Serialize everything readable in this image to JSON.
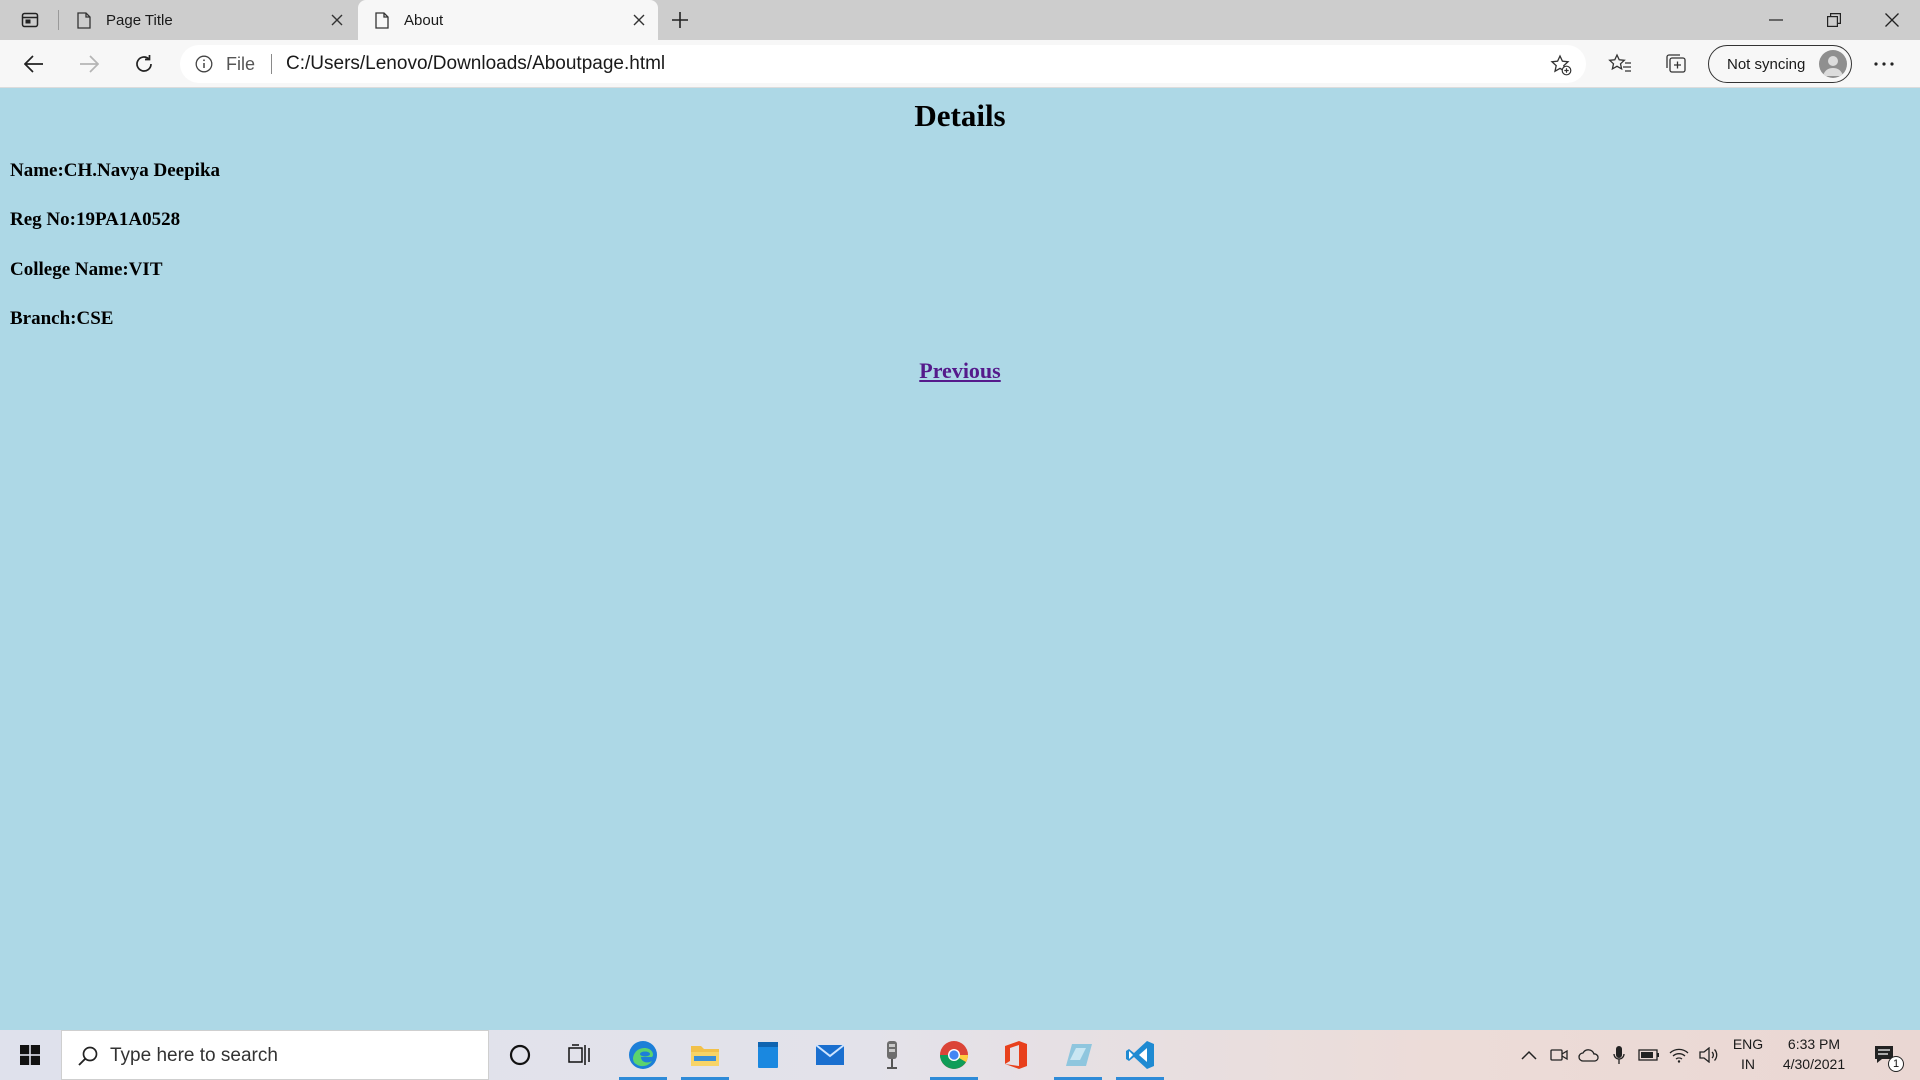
{
  "browser": {
    "tabs": [
      {
        "title": "Page Title",
        "active": false
      },
      {
        "title": "About",
        "active": true
      }
    ],
    "address": {
      "scheme_label": "File",
      "url": "C:/Users/Lenovo/Downloads/Aboutpage.html"
    },
    "profile_label": "Not syncing"
  },
  "page": {
    "heading": "Details",
    "details": [
      "Name:CH.Navya Deepika",
      "Reg No:19PA1A0528",
      "College Name:VIT",
      "Branch:CSE"
    ],
    "link_text": "Previous",
    "background_color": "#add8e6"
  },
  "taskbar": {
    "search_placeholder": "Type here to search",
    "pinned_apps": [
      "cortana-icon",
      "task-view-icon",
      "edge-icon",
      "file-explorer-icon",
      "notepad-icon",
      "mail-icon",
      "microphone-app-icon",
      "chrome-icon",
      "office-icon",
      "pen-app-icon",
      "vscode-icon"
    ],
    "language": {
      "line1": "ENG",
      "line2": "IN"
    },
    "clock": {
      "time": "6:33 PM",
      "date": "4/30/2021"
    },
    "notification_count": "1"
  }
}
